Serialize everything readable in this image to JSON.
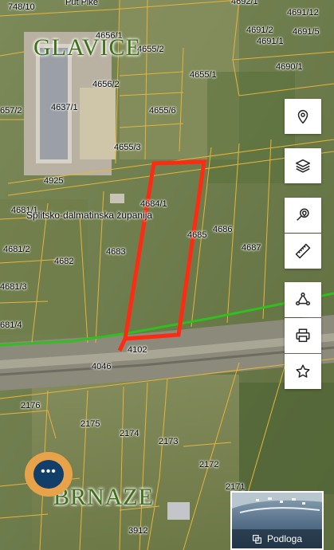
{
  "map": {
    "places": [
      "GLAVICE",
      "BRNAZE"
    ],
    "region": "Splitsko-dalmatinska županija",
    "street_top": "Put Pike",
    "parcels": [
      "748/10",
      "4692/1",
      "4691/12",
      "4691/2",
      "4656/1",
      "4655/2",
      "4691/5",
      "4691/1",
      "4690/1",
      "4656/2",
      "4655/1",
      "657/2",
      "4637/1",
      "4655/6",
      "4655/3",
      "4925",
      "4684/1",
      "4681/1",
      "4685",
      "4686",
      "4681/2",
      "4683",
      "4687",
      "4682",
      "4681/3",
      "681/4",
      "4102",
      "4046",
      "2176",
      "2175",
      "2174",
      "2173",
      "2172",
      "2171",
      "3912"
    ],
    "selection_color": "#ff2a12",
    "boundary_color": "#e6b43a",
    "road_line_color": "#2fbf1f"
  },
  "toolbar": {
    "buttons": [
      {
        "id": "location",
        "icon": "location-pin-icon"
      },
      {
        "id": "layers",
        "icon": "layers-icon"
      },
      {
        "id": "search-location",
        "icon": "search-location-icon"
      },
      {
        "id": "measure",
        "icon": "ruler-icon"
      },
      {
        "id": "polygon",
        "icon": "polygon-icon"
      },
      {
        "id": "print",
        "icon": "printer-icon"
      },
      {
        "id": "favorites",
        "icon": "star-icon"
      }
    ]
  },
  "chat": {
    "icon": "chat-bubble-icon",
    "dots": "•••"
  },
  "basemap": {
    "label": "Podloga",
    "icon": "basemap-icon"
  }
}
